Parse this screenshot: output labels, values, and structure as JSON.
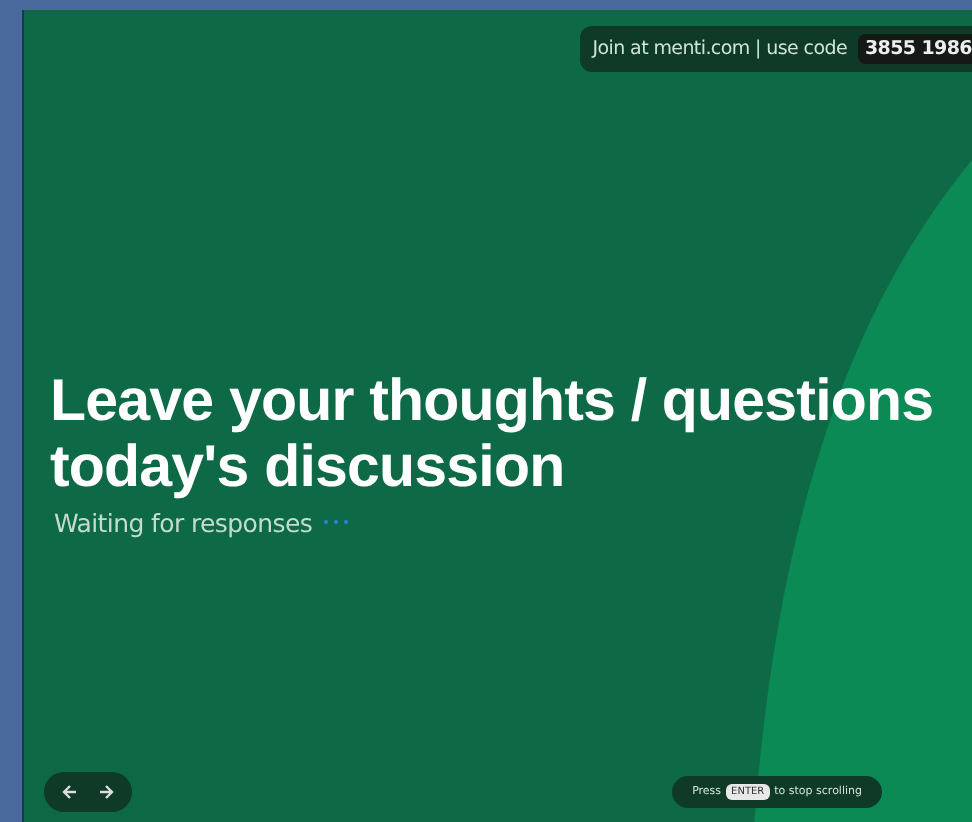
{
  "join_banner": {
    "text": "Join at menti.com | use code",
    "code": "3855 1986"
  },
  "question": {
    "title": "Leave your thoughts / questions today's discussion",
    "status": "Waiting for responses"
  },
  "scroll_hint": {
    "before": "Press",
    "key": "ENTER",
    "after": "to stop scrolling"
  }
}
